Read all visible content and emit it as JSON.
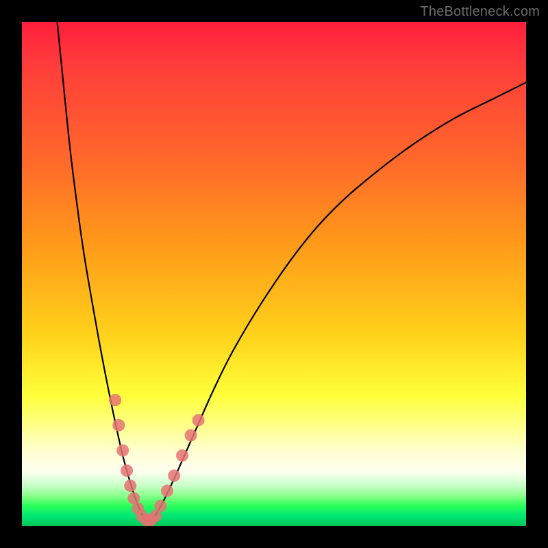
{
  "watermark": "TheBottleneck.com",
  "chart_data": {
    "type": "line",
    "title": "",
    "xlabel": "",
    "ylabel": "",
    "xlim": [
      0,
      100
    ],
    "ylim": [
      0,
      100
    ],
    "grid": false,
    "legend": false,
    "series": [
      {
        "name": "bottleneck-curve",
        "color": "#000000",
        "x": [
          7,
          8,
          9,
          10,
          12,
          14,
          16,
          18,
          20,
          22,
          23.5,
          25,
          27,
          30,
          34,
          38,
          42,
          48,
          55,
          62,
          70,
          78,
          86,
          94,
          100
        ],
        "y": [
          100,
          90,
          80,
          71,
          56,
          44,
          33,
          23,
          14,
          7,
          3,
          1,
          3,
          9,
          18,
          27,
          35,
          45,
          55,
          63,
          70,
          76,
          81,
          85,
          88
        ]
      }
    ],
    "markers": [
      {
        "name": "highlight-dots",
        "color": "#e57373",
        "points": [
          {
            "x": 18.5,
            "y": 25
          },
          {
            "x": 19.2,
            "y": 20
          },
          {
            "x": 20.0,
            "y": 15
          },
          {
            "x": 20.8,
            "y": 11
          },
          {
            "x": 21.5,
            "y": 8
          },
          {
            "x": 22.2,
            "y": 5.5
          },
          {
            "x": 23.0,
            "y": 3.5
          },
          {
            "x": 23.8,
            "y": 2
          },
          {
            "x": 24.7,
            "y": 1.2
          },
          {
            "x": 25.6,
            "y": 1.2
          },
          {
            "x": 26.5,
            "y": 2
          },
          {
            "x": 27.5,
            "y": 4
          },
          {
            "x": 28.8,
            "y": 7
          },
          {
            "x": 30.2,
            "y": 10
          },
          {
            "x": 31.8,
            "y": 14
          },
          {
            "x": 33.5,
            "y": 18
          },
          {
            "x": 35.0,
            "y": 21
          }
        ]
      }
    ]
  }
}
